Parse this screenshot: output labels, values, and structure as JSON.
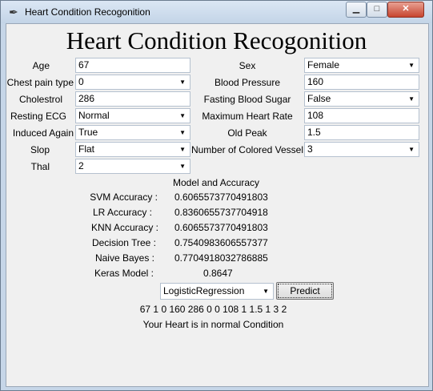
{
  "window": {
    "title": "Heart Condition Recogonition"
  },
  "heading": "Heart Condition Recogonition",
  "form": {
    "age": {
      "label": "Age",
      "value": "67"
    },
    "sex": {
      "label": "Sex",
      "value": "Female"
    },
    "chest_pain_type": {
      "label": "Chest pain type",
      "value": "0"
    },
    "blood_pressure": {
      "label": "Blood Pressure",
      "value": "160"
    },
    "cholestrol": {
      "label": "Cholestrol",
      "value": "286"
    },
    "fasting_blood_sugar": {
      "label": "Fasting Blood Sugar",
      "value": "False"
    },
    "resting_ecg": {
      "label": "Resting ECG",
      "value": "Normal"
    },
    "max_heart_rate": {
      "label": "Maximum Heart Rate",
      "value": "108"
    },
    "induced_again": {
      "label": "Induced Again",
      "value": "True"
    },
    "old_peak": {
      "label": "Old Peak",
      "value": "1.5"
    },
    "slop": {
      "label": "Slop",
      "value": "Flat"
    },
    "colored_vessel": {
      "label": "Number of Colored Vessel",
      "value": "3"
    },
    "thal": {
      "label": "Thal",
      "value": "2"
    }
  },
  "accuracy": {
    "header": "Model and Accuracy",
    "rows": [
      {
        "label": "SVM Accuracy :",
        "value": "0.6065573770491803"
      },
      {
        "label": "LR Accuracy :",
        "value": "0.8360655737704918"
      },
      {
        "label": "KNN Accuracy :",
        "value": "0.6065573770491803"
      },
      {
        "label": "Decision Tree :",
        "value": "0.7540983606557377"
      },
      {
        "label": "Naive Bayes :",
        "value": "0.7704918032786885"
      },
      {
        "label": "Keras Model :",
        "value": "0.8647"
      }
    ]
  },
  "model_select": {
    "value": "LogisticRegression"
  },
  "predict_button": {
    "label": "Predict"
  },
  "input_vector": "67 1 0 160 286 0 0 108 1 1.5 1 3 2",
  "result": "Your Heart is in normal Condition"
}
